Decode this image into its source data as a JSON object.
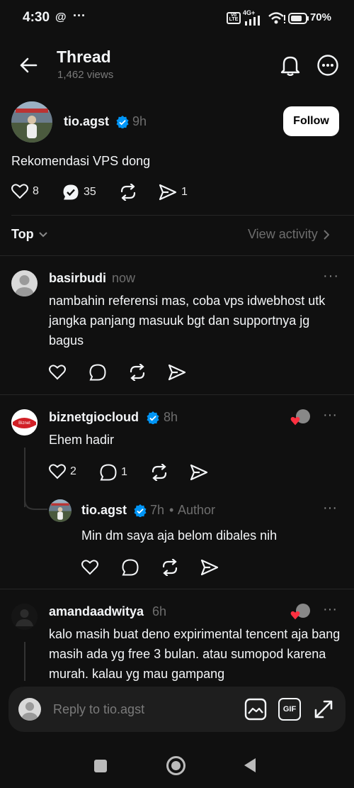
{
  "status_bar": {
    "time": "4:30",
    "battery": "70%",
    "network": "4G+"
  },
  "header": {
    "title": "Thread",
    "views": "1,462 views"
  },
  "post": {
    "username": "tio.agst",
    "time": "9h",
    "follow_label": "Follow",
    "text": "Rekomendasi VPS dong",
    "likes": "8",
    "replies": "35",
    "shares": "1"
  },
  "sort": {
    "label": "Top",
    "view_activity": "View activity"
  },
  "replies": [
    {
      "username": "basirbudi",
      "time": "now",
      "text": "nambahin referensi mas, coba vps idwebhost utk jangka panjang masuuk bgt dan supportnya jg bagus"
    },
    {
      "username": "biznetgiocloud",
      "time": "8h",
      "text": "Ehem hadir",
      "likes": "2",
      "replies": "1",
      "avatar_label": "Biznet"
    },
    {
      "username": "tio.agst",
      "time": "7h",
      "author_tag": "Author",
      "text": "Min dm saya aja belom dibales nih"
    },
    {
      "username": "amandaadwitya",
      "time": "6h",
      "text": "kalo masih buat deno expirimental tencent aja bang masih ada yg free 3 bulan. atau sumopod karena murah. kalau yg mau gampang"
    }
  ],
  "reply_bar": {
    "placeholder": "Reply to tio.agst",
    "gif_label": "GIF"
  },
  "colors": {
    "background": "#101010",
    "verified": "#0095f6",
    "text": "#f3f5f7",
    "muted": "#777777",
    "like_heart": "#ff3040"
  }
}
